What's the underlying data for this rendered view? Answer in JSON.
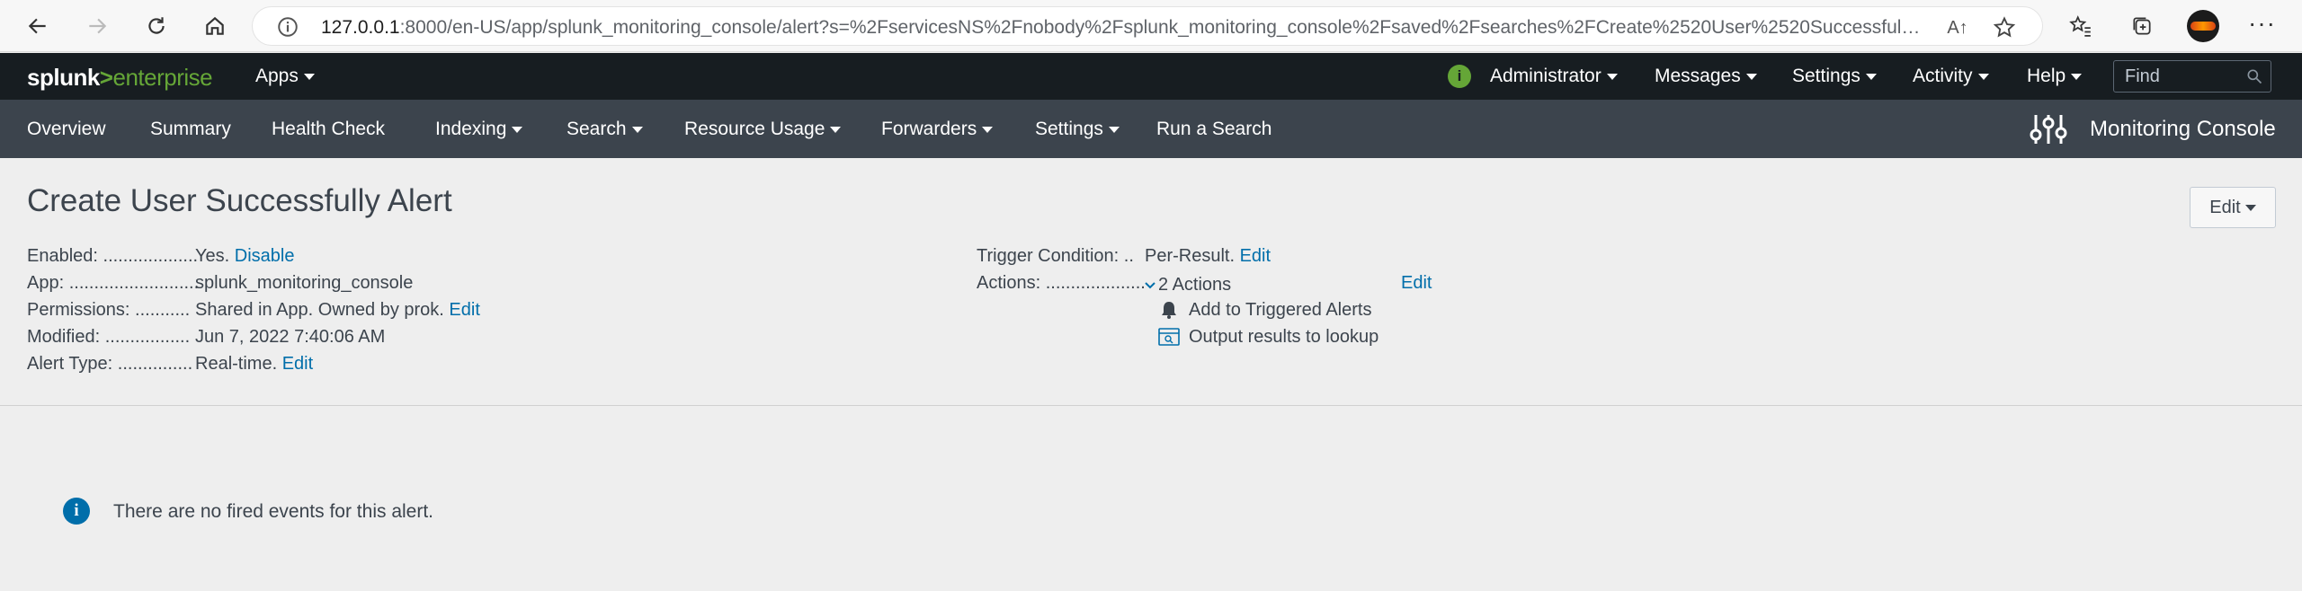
{
  "browser": {
    "url_host": "127.0.0.1",
    "url_rest": ":8000/en-US/app/splunk_monitoring_console/alert?s=%2FservicesNS%2Fnobody%2Fsplunk_monitoring_console%2Fsaved%2Fsearches%2FCreate%2520User%2520Successfully%2520A...",
    "read_aloud_label": "A↑"
  },
  "splunk_bar": {
    "logo_left": "splunk",
    "logo_gt": ">",
    "logo_right": "enterprise",
    "apps_label": "Apps",
    "user_label": "Administrator",
    "messages_label": "Messages",
    "settings_label": "Settings",
    "activity_label": "Activity",
    "help_label": "Help",
    "find_placeholder": "Find",
    "status_glyph": "i"
  },
  "app_nav": {
    "items": [
      "Overview",
      "Summary",
      "Health Check",
      "Indexing",
      "Search",
      "Resource Usage",
      "Forwarders",
      "Settings",
      "Run a Search"
    ],
    "app_title": "Monitoring Console"
  },
  "alert": {
    "title": "Create User Successfully Alert",
    "edit_label": "Edit",
    "left": {
      "enabled_label": "Enabled: ...................",
      "enabled_value": "Yes.",
      "enabled_link": "Disable",
      "app_label": "App: ..........................",
      "app_value": "splunk_monitoring_console",
      "permissions_label": "Permissions: ...........",
      "permissions_value": "Shared in App. Owned by prok.",
      "permissions_link": "Edit",
      "modified_label": "Modified: .................",
      "modified_value": "Jun 7, 2022 7:40:06 AM",
      "alert_type_label": "Alert Type: ...............",
      "alert_type_value": "Real-time.",
      "alert_type_link": "Edit"
    },
    "right": {
      "trigger_label": "Trigger Condition: ..",
      "trigger_value": "Per-Result.",
      "trigger_link": "Edit",
      "actions_label": "Actions: ....................",
      "actions_value": "2 Actions",
      "actions_link": "Edit",
      "action_items": [
        "Add to Triggered Alerts",
        "Output results to lookup"
      ]
    }
  },
  "events": {
    "info_glyph": "i",
    "message": "There are no fired events for this alert."
  },
  "colors": {
    "splunk_green": "#65a637",
    "top_bar": "#171d21",
    "app_bar": "#3c444d",
    "link": "#006eaa"
  }
}
